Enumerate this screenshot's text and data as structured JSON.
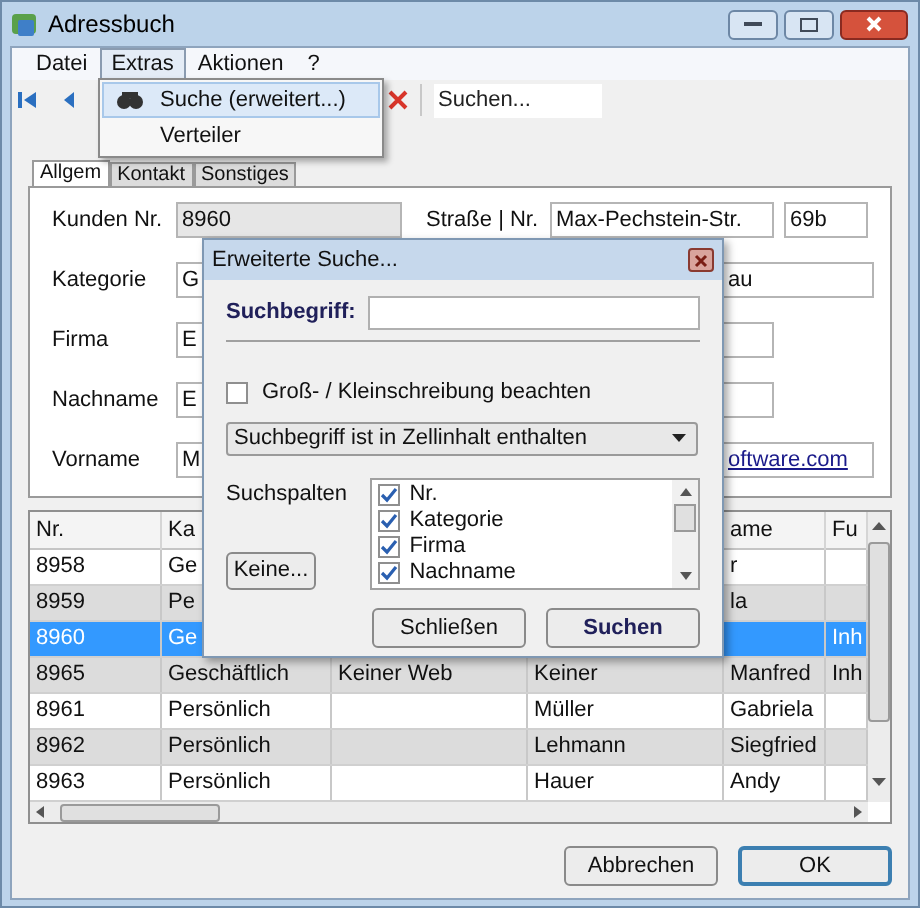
{
  "window": {
    "title": "Adressbuch"
  },
  "menu_bar": [
    {
      "label": "Datei",
      "selected": false
    },
    {
      "label": "Extras",
      "selected": true
    },
    {
      "label": "Aktionen",
      "selected": false
    },
    {
      "label": "?",
      "selected": false
    }
  ],
  "menu_dropdown": [
    {
      "label": "Suche (erweitert...)",
      "selected": true,
      "kind": "icon"
    },
    {
      "label": "Verteiler",
      "selected": false,
      "kind": "plain"
    }
  ],
  "toolbar": {
    "search_field": "Suchen..."
  },
  "tabs": [
    {
      "label": "Allgem",
      "selected": true
    },
    {
      "label": "Kontakt",
      "selected": false
    },
    {
      "label": "Sonstiges",
      "selected": false
    }
  ],
  "form": [
    {
      "label": "Kunden Nr.",
      "value": "8960",
      "readonly": true,
      "right": {
        "kind": "double",
        "label": "Straße | Nr.",
        "value": "Max-Pechstein-Str.",
        "extra": "69b"
      }
    },
    {
      "label": "Kategorie",
      "value": "G",
      "readonly": false,
      "right": {
        "kind": "wide",
        "value": "au"
      }
    },
    {
      "label": "Firma",
      "value": "E",
      "readonly": false,
      "right": {
        "kind": "field"
      }
    },
    {
      "label": "Nachname",
      "value": "E",
      "readonly": false,
      "right": {
        "kind": "field"
      }
    },
    {
      "label": "Vorname",
      "value": "M",
      "readonly": false,
      "right": {
        "kind": "link",
        "value": "oftware.com"
      }
    }
  ],
  "grid": {
    "columns": [
      {
        "label": "Nr."
      },
      {
        "label": "Ka"
      },
      {},
      {},
      {
        "label": "ame"
      },
      {
        "label": "Fu"
      }
    ],
    "rows": [
      {
        "selected": false,
        "cells": [
          "8958",
          "Ge",
          null,
          null,
          "r",
          null
        ]
      },
      {
        "selected": false,
        "cells": [
          "8959",
          "Pe",
          null,
          null,
          "la",
          null
        ]
      },
      {
        "selected": true,
        "cells": [
          "8960",
          "Ge",
          null,
          null,
          null,
          "Inh"
        ]
      },
      {
        "selected": false,
        "cells": [
          "8965",
          "Geschäftlich",
          "Keiner Web",
          "Keiner",
          "Manfred",
          "Inh"
        ]
      },
      {
        "selected": false,
        "cells": [
          "8961",
          "Persönlich",
          null,
          "Müller",
          "Gabriela",
          null
        ]
      },
      {
        "selected": false,
        "cells": [
          "8962",
          "Persönlich",
          null,
          "Lehmann",
          "Siegfried",
          null
        ]
      },
      {
        "selected": false,
        "cells": [
          "8963",
          "Persönlich",
          null,
          "Hauer",
          "Andy",
          null
        ]
      }
    ]
  },
  "buttons": [
    {
      "label": "Abbrechen",
      "kind": "normal"
    },
    {
      "label": "OK",
      "kind": "default"
    }
  ],
  "dialog": {
    "title": "Erweiterte Suche...",
    "search_label": "Suchbegriff:",
    "case_checkbox": {
      "label": "Groß- / Kleinschreibung beachten",
      "checked": false
    },
    "match_mode": "Suchbegriff ist in Zellinhalt enthalten",
    "columns_label": "Suchspalten",
    "columns": [
      {
        "label": "Nr.",
        "checked": true
      },
      {
        "label": "Kategorie",
        "checked": true
      },
      {
        "label": "Firma",
        "checked": true
      },
      {
        "label": "Nachname",
        "checked": true
      }
    ],
    "none_button": "Keine...",
    "buttons": [
      {
        "label": "Schließen",
        "kind": "normal"
      },
      {
        "label": "Suchen",
        "kind": "default"
      }
    ]
  }
}
